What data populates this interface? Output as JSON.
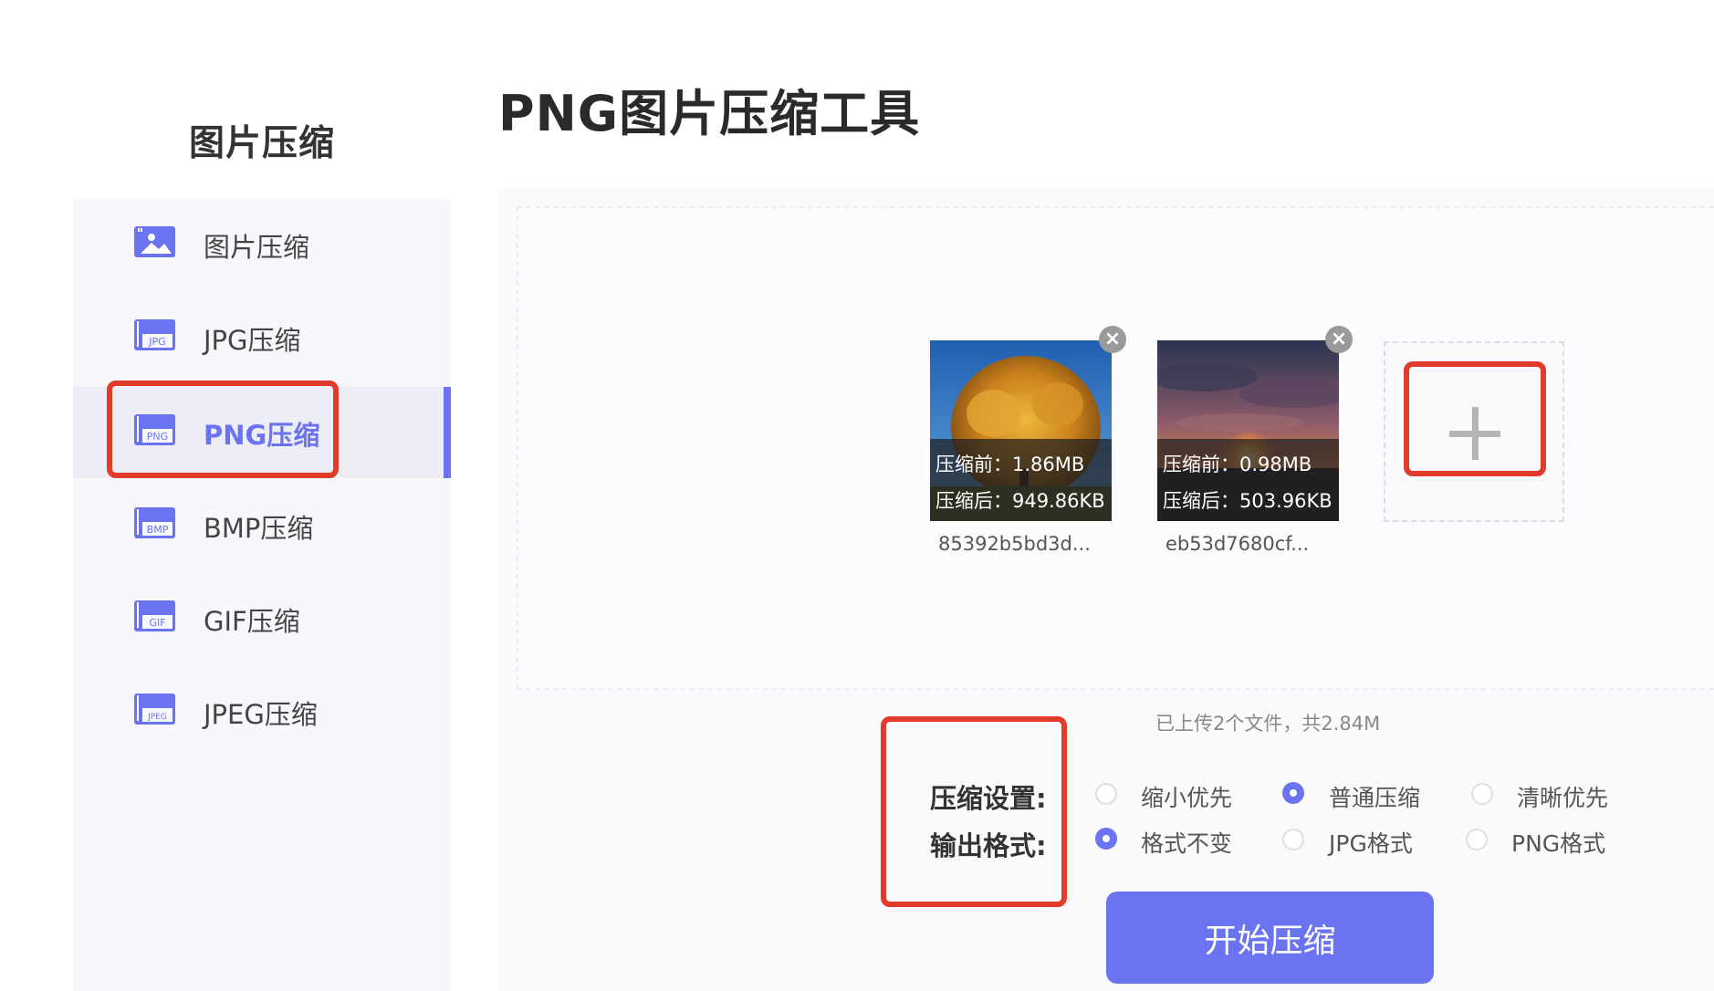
{
  "sidebar": {
    "title": "图片压缩",
    "items": [
      {
        "label": "图片压缩",
        "badge": ""
      },
      {
        "label": "JPG压缩",
        "badge": "JPG"
      },
      {
        "label": "PNG压缩",
        "badge": "PNG"
      },
      {
        "label": "BMP压缩",
        "badge": "BMP"
      },
      {
        "label": "GIF压缩",
        "badge": "GIF"
      },
      {
        "label": "JPEG压缩",
        "badge": "JPEG"
      }
    ],
    "active_index": 2
  },
  "main": {
    "title": "PNG图片压缩工具",
    "files": [
      {
        "before": "压缩前：1.86MB",
        "after": "压缩后：949.86KB",
        "name": "85392b5bd3d..."
      },
      {
        "before": "压缩前：0.98MB",
        "after": "压缩后：503.96KB",
        "name": "eb53d7680cf..."
      }
    ],
    "remove_label": "×",
    "upload_status": "已上传2个文件，共2.84M",
    "compression_setting": {
      "label": "压缩设置:",
      "options": [
        "缩小优先",
        "普通压缩",
        "清晰优先"
      ],
      "selected": "普通压缩"
    },
    "output_format": {
      "label": "输出格式:",
      "options": [
        "格式不变",
        "JPG格式",
        "PNG格式"
      ],
      "selected": "格式不变"
    },
    "start_button": "开始压缩"
  },
  "colors": {
    "accent": "#6a73f0",
    "highlight": "#e03b2b"
  }
}
